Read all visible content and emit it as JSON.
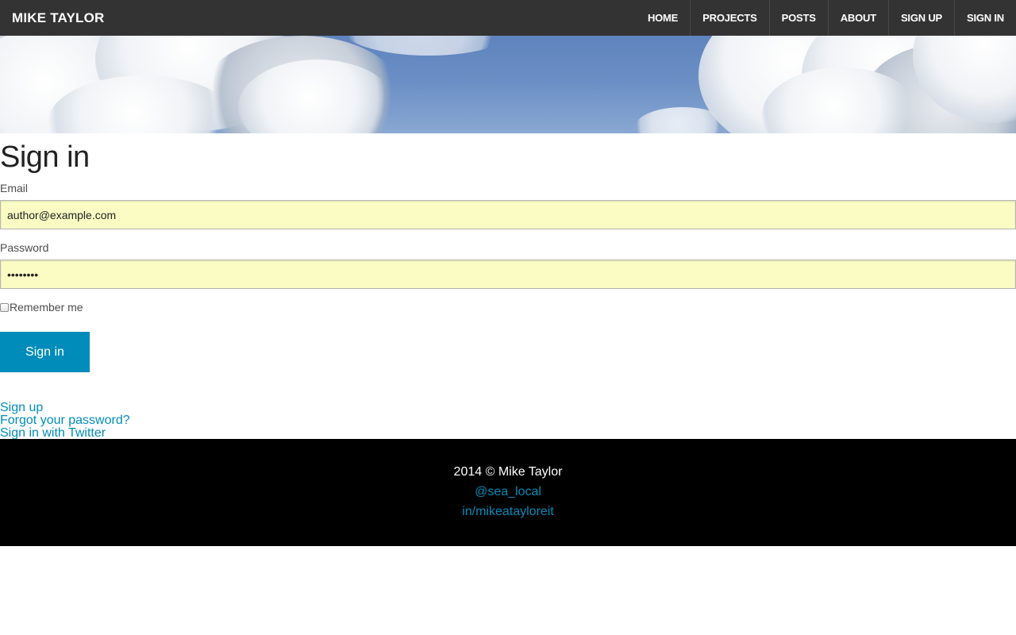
{
  "navbar": {
    "brand": "MIKE TAYLOR",
    "items": [
      {
        "label": "HOME"
      },
      {
        "label": "PROJECTS"
      },
      {
        "label": "POSTS"
      },
      {
        "label": "ABOUT"
      },
      {
        "label": "SIGN UP"
      },
      {
        "label": "SIGN IN"
      }
    ]
  },
  "form": {
    "title": "Sign in",
    "email_label": "Email",
    "email_value": "author@example.com",
    "password_label": "Password",
    "password_value": "••••••••",
    "remember_label": "Remember me",
    "remember_checked": false,
    "submit_label": "Sign in"
  },
  "links": {
    "sign_up": "Sign up",
    "forgot_password": "Forgot your password?",
    "twitter": "Sign in with Twitter"
  },
  "footer": {
    "copyright": "2014 © Mike Taylor",
    "twitter_handle": "@sea_local",
    "linkedin": "in/mikeatayloreit"
  },
  "colors": {
    "navbar_bg": "#333333",
    "accent": "#008cba",
    "input_bg": "#fafcc4",
    "footer_bg": "#000000"
  }
}
